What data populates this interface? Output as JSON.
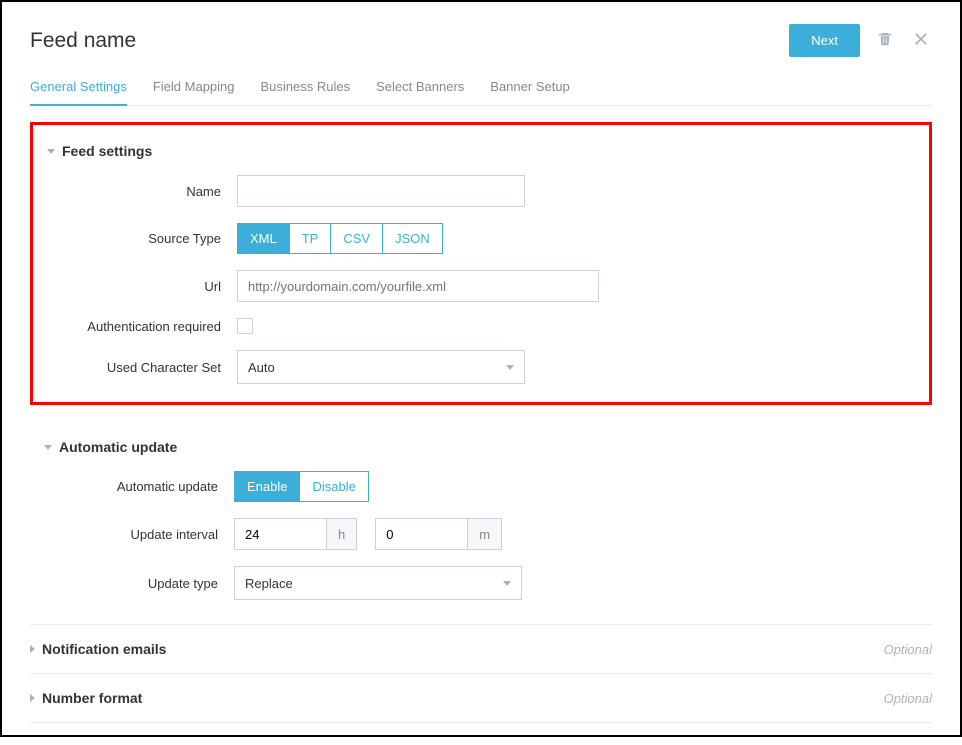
{
  "header": {
    "title": "Feed name",
    "next_label": "Next"
  },
  "tabs": [
    {
      "label": "General Settings",
      "active": true
    },
    {
      "label": "Field Mapping",
      "active": false
    },
    {
      "label": "Business Rules",
      "active": false
    },
    {
      "label": "Select Banners",
      "active": false
    },
    {
      "label": "Banner Setup",
      "active": false
    }
  ],
  "feed_settings": {
    "title": "Feed settings",
    "name_label": "Name",
    "name_value": "",
    "source_type_label": "Source Type",
    "source_types": [
      {
        "label": "XML",
        "active": true
      },
      {
        "label": "TP",
        "active": false
      },
      {
        "label": "CSV",
        "active": false
      },
      {
        "label": "JSON",
        "active": false
      }
    ],
    "url_label": "Url",
    "url_placeholder": "http://yourdomain.com/yourfile.xml",
    "url_value": "",
    "auth_label": "Authentication required",
    "auth_checked": false,
    "charset_label": "Used Character Set",
    "charset_value": "Auto"
  },
  "automatic_update": {
    "title": "Automatic update",
    "toggle_label": "Automatic update",
    "toggle_options": [
      {
        "label": "Enable",
        "active": true
      },
      {
        "label": "Disable",
        "active": false
      }
    ],
    "interval_label": "Update interval",
    "interval_h": "24",
    "interval_h_unit": "h",
    "interval_m": "0",
    "interval_m_unit": "m",
    "update_type_label": "Update type",
    "update_type_value": "Replace"
  },
  "notification_emails": {
    "title": "Notification emails",
    "badge": "Optional"
  },
  "number_format": {
    "title": "Number format",
    "badge": "Optional"
  }
}
